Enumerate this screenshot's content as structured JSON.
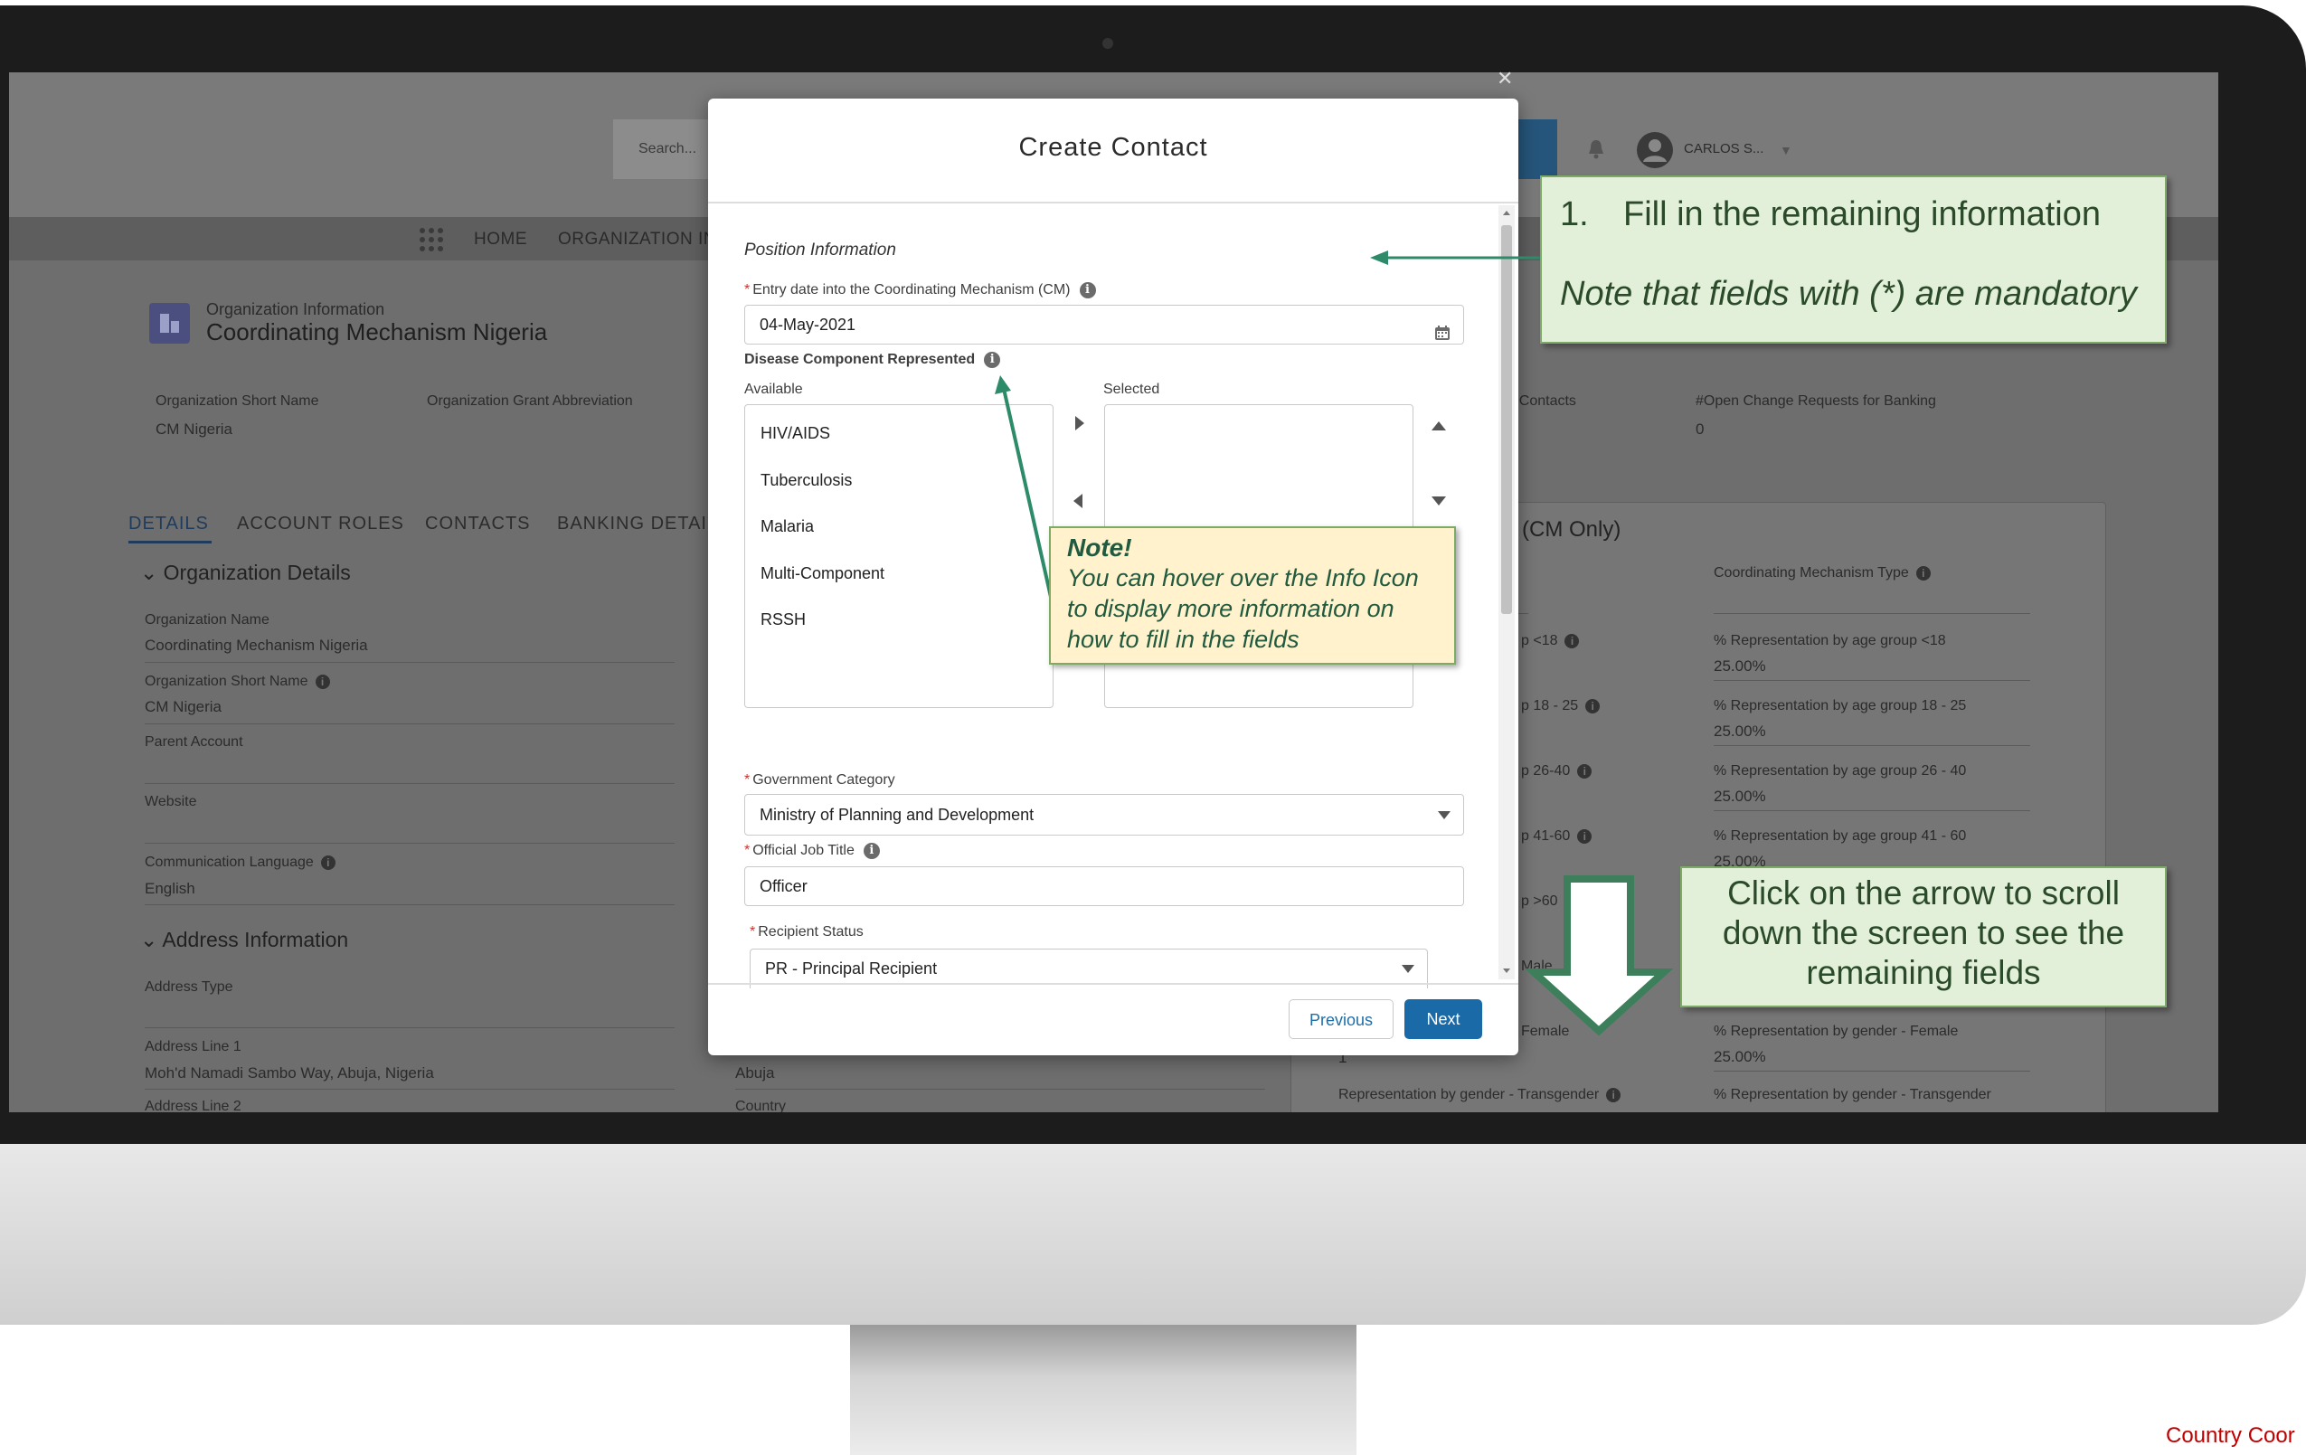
{
  "app": {
    "search_placeholder": "Search...",
    "user_name": "CARLOS S...",
    "nav": [
      "HOME",
      "ORGANIZATION IN"
    ]
  },
  "record": {
    "object_label": "Organization Information",
    "name": "Coordinating Mechanism Nigeria",
    "highlights": [
      {
        "label": "Organization Short Name",
        "value": "CM Nigeria"
      },
      {
        "label": "Organization Grant Abbreviation",
        "value": ""
      }
    ],
    "right_highlights": [
      {
        "label": "r Contacts",
        "value": ""
      },
      {
        "label": "#Open Change Requests for Banking",
        "value": "0"
      }
    ],
    "tabs": [
      "DETAILS",
      "ACCOUNT ROLES",
      "CONTACTS",
      "BANKING DETAI"
    ]
  },
  "details": {
    "section1": "Organization Details",
    "fields": [
      {
        "label": "Organization Name",
        "value": "Coordinating Mechanism Nigeria"
      },
      {
        "label": "Organization Short Name",
        "value": "CM Nigeria"
      },
      {
        "label": "Parent Account",
        "value": ""
      },
      {
        "label": "Website",
        "value": ""
      },
      {
        "label": "Communication Language",
        "value": "English"
      }
    ],
    "section2": "Address Information",
    "address": [
      {
        "label": "Address Type",
        "value": ""
      },
      {
        "label": "Address Line 1",
        "value": "Moh'd Namadi Sambo Way, Abuja, Nigeria"
      },
      {
        "label": "Address Line 2",
        "value": ""
      }
    ],
    "city_value": "Abuja",
    "country_label": "Country"
  },
  "cm_panel": {
    "title": "(CM Only)",
    "type_label": "Coordinating Mechanism Type",
    "left_labels": [
      "p <18",
      "p 18 - 25",
      "p 26-40",
      "p 41-60",
      "p >60",
      "Male",
      "Female"
    ],
    "left_value": "1",
    "left_bottom_label": "Representation by gender - Transgender",
    "rows": [
      {
        "label": "% Representation by age group <18",
        "value": "25.00%"
      },
      {
        "label": "% Representation by age group 18 - 25",
        "value": "25.00%"
      },
      {
        "label": "% Representation by age group 26 - 40",
        "value": "25.00%"
      },
      {
        "label": "% Representation by age group 41 - 60",
        "value": "25.00%"
      },
      {
        "label": "% Representation by gender - Female",
        "value": "25.00%"
      },
      {
        "label": "% Representation by gender - Transgender",
        "value": ""
      }
    ]
  },
  "modal": {
    "title": "Create Contact",
    "section": "Position Information",
    "entry_date_label": "Entry date into the Coordinating Mechanism (CM)",
    "entry_date_value": "04-May-2021",
    "disease_label": "Disease Component Represented",
    "available_label": "Available",
    "selected_label": "Selected",
    "available_options": [
      "HIV/AIDS",
      "Tuberculosis",
      "Malaria",
      "Multi-Component",
      "RSSH"
    ],
    "gov_category_label": "Government Category",
    "gov_category_value": "Ministry of Planning and Development",
    "job_title_label": "Official Job Title",
    "job_title_value": "Officer",
    "recipient_label": "Recipient Status",
    "recipient_value": "PR - Principal Recipient",
    "previous_label": "Previous",
    "next_label": "Next"
  },
  "callouts": {
    "step_number": "1.",
    "step_text": "Fill in the remaining information",
    "step_note": "Note that fields with (*) are mandatory",
    "note_title": "Note!",
    "note_text": "You can hover over the Info Icon to display more information on how to fill in the fields",
    "scroll_text": "Click on the arrow to scroll down the screen to see the remaining fields"
  },
  "footer": {
    "text": "Country Coor"
  },
  "colors": {
    "accent": "#1b6aa8",
    "callout_bg": "#e2efd9",
    "callout_border": "#7dab67",
    "note_bg": "#fff2cc",
    "arrow": "#2e8b6a",
    "footer": "#c00000"
  }
}
